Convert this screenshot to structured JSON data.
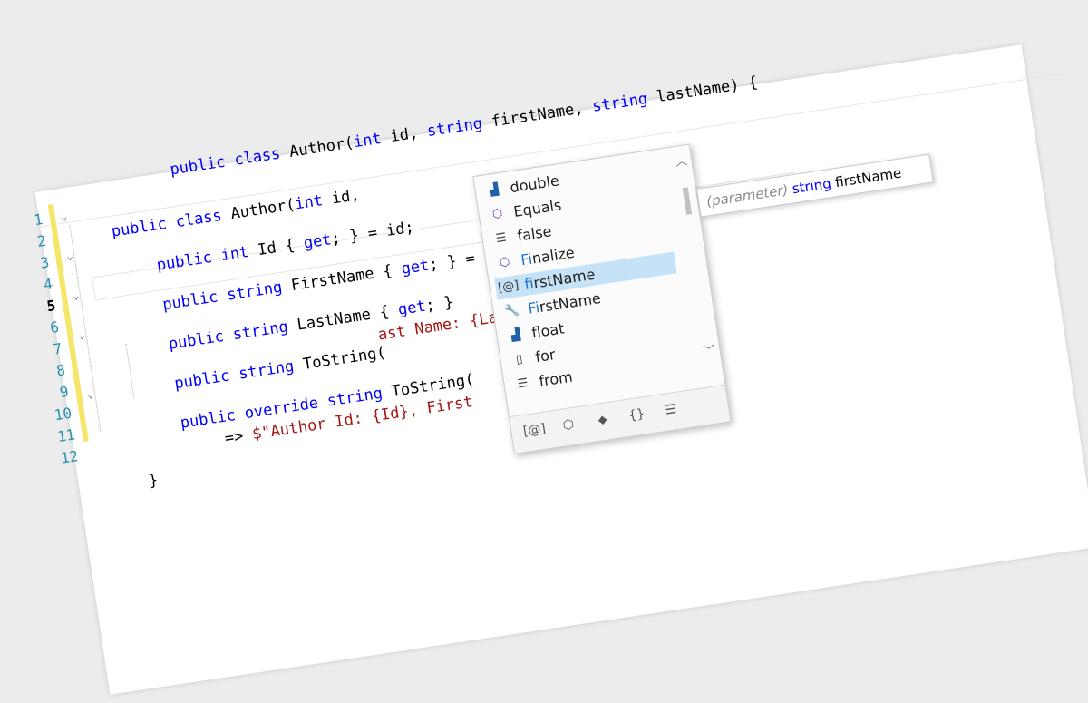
{
  "editor": {
    "line_numbers": [
      "1",
      "2",
      "3",
      "4",
      "5",
      "6",
      "7",
      "8",
      "9",
      "10",
      "11",
      "12"
    ],
    "current_line": "5",
    "code": {
      "line0": "public class Author(int id, string firstName, string lastName) {",
      "line1_kw1": "public",
      "line1_kw2": "class",
      "line1_rest": "Author(",
      "line1_int": "int",
      "line1_id": " id, ",
      "line1_string1": "string",
      "line1_fn": " firstName, ",
      "line1_string2": "string",
      "line1_ln": " lastName) {",
      "line2_kw1": "public",
      "line2_kw2": "int",
      "line2_rest": " Id { ",
      "line2_get": "get",
      "line2_end": "; } = id;",
      "line3_kw1": "public",
      "line3_kw2": "string",
      "line3_rest": " FirstName { ",
      "line3_get": "get",
      "line3_end": "; } = fi",
      "line3_semi": ";",
      "line4_kw1": "public",
      "line4_kw2": "string",
      "line4_rest": " LastName { ",
      "line4_get": "get",
      "line4_end": "; }",
      "line5_kw1": "public",
      "line5_kw2": "string",
      "line5_rest": " ToString(",
      "line5_tail": "ast Name: {LastName}\";",
      "line6_kw1": "public",
      "line6_kw2": "override",
      "line6_kw3": "string",
      "line6_rest": " ToString(",
      "line7_arrow": "=> ",
      "line7_str": "$\"Author Id: {Id}, First",
      "line8_close": "}"
    }
  },
  "completion": {
    "items": [
      {
        "icon": "struct-icon",
        "match": "",
        "text": "double"
      },
      {
        "icon": "method-icon",
        "match": "",
        "text": "Equals"
      },
      {
        "icon": "keyword-icon",
        "match": "",
        "text": "false"
      },
      {
        "icon": "method-protected-icon",
        "match": "Fi",
        "text": "nalize"
      },
      {
        "icon": "parameter-icon",
        "match": "fi",
        "text": "rstName"
      },
      {
        "icon": "property-icon",
        "match": "Fi",
        "text": "rstName"
      },
      {
        "icon": "struct-icon",
        "match": "",
        "text": "float"
      },
      {
        "icon": "snippet-icon",
        "match": "",
        "text": "for"
      },
      {
        "icon": "keyword-icon",
        "match": "",
        "text": "from"
      }
    ],
    "selected_index": 4,
    "filters": [
      "[@]",
      "⬡",
      "⬥",
      "{}",
      "☰"
    ]
  },
  "tooltip": {
    "kind": "(parameter)",
    "type": "string",
    "name": "firstName"
  }
}
